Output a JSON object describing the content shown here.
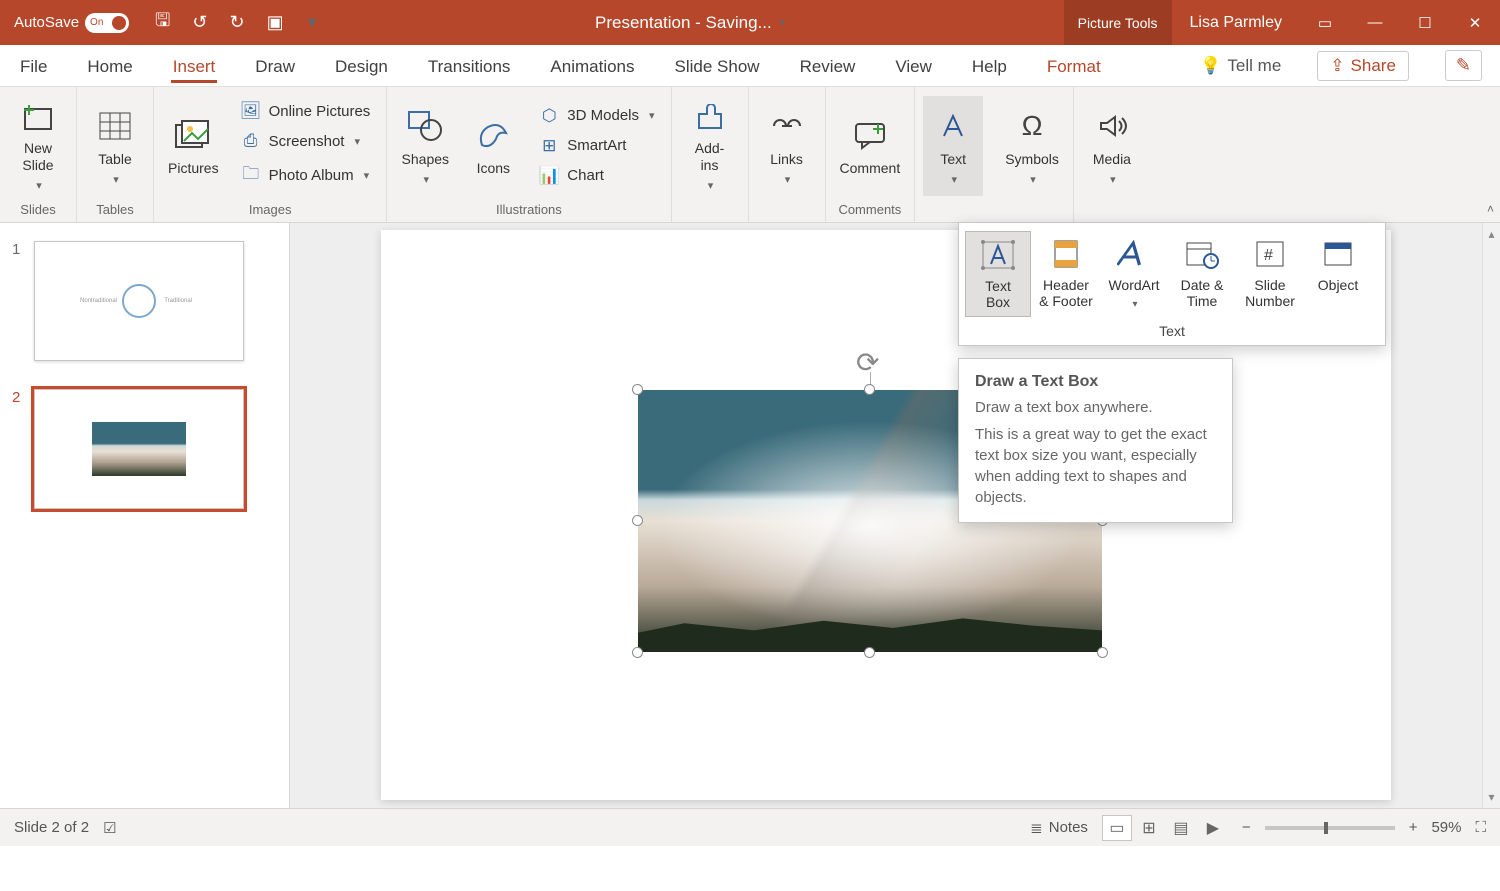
{
  "titlebar": {
    "autosave_label": "AutoSave",
    "autosave_state": "On",
    "doc_title": "Presentation  -  Saving...",
    "context_tab": "Picture Tools",
    "user": "Lisa Parmley"
  },
  "tabs": {
    "file": "File",
    "home": "Home",
    "insert": "Insert",
    "draw": "Draw",
    "design": "Design",
    "transitions": "Transitions",
    "animations": "Animations",
    "slideshow": "Slide Show",
    "review": "Review",
    "view": "View",
    "help": "Help",
    "format": "Format",
    "tell_me": "Tell me",
    "share": "Share"
  },
  "ribbon": {
    "slides": {
      "label": "Slides",
      "new_slide": "New\nSlide"
    },
    "tables": {
      "label": "Tables",
      "table": "Table"
    },
    "images": {
      "label": "Images",
      "pictures": "Pictures",
      "online_pictures": "Online Pictures",
      "screenshot": "Screenshot",
      "photo_album": "Photo Album"
    },
    "illustrations": {
      "label": "Illustrations",
      "shapes": "Shapes",
      "icons": "Icons",
      "models3d": "3D Models",
      "smartart": "SmartArt",
      "chart": "Chart"
    },
    "addins": {
      "label": "Add-\nins"
    },
    "links": {
      "label": "Links"
    },
    "comments": {
      "label": "Comments",
      "comment": "Comment"
    },
    "text": {
      "label": "Text"
    },
    "symbols": {
      "label": "Symbols"
    },
    "media": {
      "label": "Media"
    }
  },
  "text_gallery": {
    "group_label": "Text",
    "text_box": "Text\nBox",
    "header_footer": "Header\n& Footer",
    "wordart": "WordArt",
    "date_time": "Date &\nTime",
    "slide_number": "Slide\nNumber",
    "object": "Object"
  },
  "tooltip": {
    "title": "Draw a Text Box",
    "line1": "Draw a text box anywhere.",
    "line2": "This is a great way to get the exact text box size you want, especially when adding text to shapes and objects."
  },
  "slide_panel": {
    "n1": "1",
    "n2": "2"
  },
  "statusbar": {
    "slide_pos": "Slide 2 of 2",
    "notes": "Notes",
    "zoom": "59%"
  }
}
